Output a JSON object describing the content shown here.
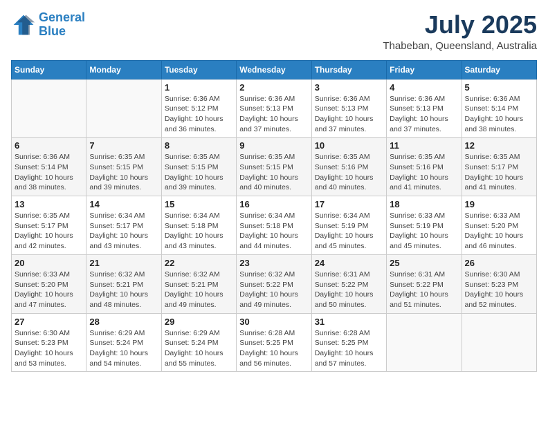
{
  "logo": {
    "line1": "General",
    "line2": "Blue"
  },
  "title": "July 2025",
  "location": "Thabeban, Queensland, Australia",
  "days_of_week": [
    "Sunday",
    "Monday",
    "Tuesday",
    "Wednesday",
    "Thursday",
    "Friday",
    "Saturday"
  ],
  "weeks": [
    [
      {
        "day": "",
        "sunrise": "",
        "sunset": "",
        "daylight": ""
      },
      {
        "day": "",
        "sunrise": "",
        "sunset": "",
        "daylight": ""
      },
      {
        "day": "1",
        "sunrise": "Sunrise: 6:36 AM",
        "sunset": "Sunset: 5:12 PM",
        "daylight": "Daylight: 10 hours and 36 minutes."
      },
      {
        "day": "2",
        "sunrise": "Sunrise: 6:36 AM",
        "sunset": "Sunset: 5:13 PM",
        "daylight": "Daylight: 10 hours and 37 minutes."
      },
      {
        "day": "3",
        "sunrise": "Sunrise: 6:36 AM",
        "sunset": "Sunset: 5:13 PM",
        "daylight": "Daylight: 10 hours and 37 minutes."
      },
      {
        "day": "4",
        "sunrise": "Sunrise: 6:36 AM",
        "sunset": "Sunset: 5:13 PM",
        "daylight": "Daylight: 10 hours and 37 minutes."
      },
      {
        "day": "5",
        "sunrise": "Sunrise: 6:36 AM",
        "sunset": "Sunset: 5:14 PM",
        "daylight": "Daylight: 10 hours and 38 minutes."
      }
    ],
    [
      {
        "day": "6",
        "sunrise": "Sunrise: 6:36 AM",
        "sunset": "Sunset: 5:14 PM",
        "daylight": "Daylight: 10 hours and 38 minutes."
      },
      {
        "day": "7",
        "sunrise": "Sunrise: 6:35 AM",
        "sunset": "Sunset: 5:15 PM",
        "daylight": "Daylight: 10 hours and 39 minutes."
      },
      {
        "day": "8",
        "sunrise": "Sunrise: 6:35 AM",
        "sunset": "Sunset: 5:15 PM",
        "daylight": "Daylight: 10 hours and 39 minutes."
      },
      {
        "day": "9",
        "sunrise": "Sunrise: 6:35 AM",
        "sunset": "Sunset: 5:15 PM",
        "daylight": "Daylight: 10 hours and 40 minutes."
      },
      {
        "day": "10",
        "sunrise": "Sunrise: 6:35 AM",
        "sunset": "Sunset: 5:16 PM",
        "daylight": "Daylight: 10 hours and 40 minutes."
      },
      {
        "day": "11",
        "sunrise": "Sunrise: 6:35 AM",
        "sunset": "Sunset: 5:16 PM",
        "daylight": "Daylight: 10 hours and 41 minutes."
      },
      {
        "day": "12",
        "sunrise": "Sunrise: 6:35 AM",
        "sunset": "Sunset: 5:17 PM",
        "daylight": "Daylight: 10 hours and 41 minutes."
      }
    ],
    [
      {
        "day": "13",
        "sunrise": "Sunrise: 6:35 AM",
        "sunset": "Sunset: 5:17 PM",
        "daylight": "Daylight: 10 hours and 42 minutes."
      },
      {
        "day": "14",
        "sunrise": "Sunrise: 6:34 AM",
        "sunset": "Sunset: 5:17 PM",
        "daylight": "Daylight: 10 hours and 43 minutes."
      },
      {
        "day": "15",
        "sunrise": "Sunrise: 6:34 AM",
        "sunset": "Sunset: 5:18 PM",
        "daylight": "Daylight: 10 hours and 43 minutes."
      },
      {
        "day": "16",
        "sunrise": "Sunrise: 6:34 AM",
        "sunset": "Sunset: 5:18 PM",
        "daylight": "Daylight: 10 hours and 44 minutes."
      },
      {
        "day": "17",
        "sunrise": "Sunrise: 6:34 AM",
        "sunset": "Sunset: 5:19 PM",
        "daylight": "Daylight: 10 hours and 45 minutes."
      },
      {
        "day": "18",
        "sunrise": "Sunrise: 6:33 AM",
        "sunset": "Sunset: 5:19 PM",
        "daylight": "Daylight: 10 hours and 45 minutes."
      },
      {
        "day": "19",
        "sunrise": "Sunrise: 6:33 AM",
        "sunset": "Sunset: 5:20 PM",
        "daylight": "Daylight: 10 hours and 46 minutes."
      }
    ],
    [
      {
        "day": "20",
        "sunrise": "Sunrise: 6:33 AM",
        "sunset": "Sunset: 5:20 PM",
        "daylight": "Daylight: 10 hours and 47 minutes."
      },
      {
        "day": "21",
        "sunrise": "Sunrise: 6:32 AM",
        "sunset": "Sunset: 5:21 PM",
        "daylight": "Daylight: 10 hours and 48 minutes."
      },
      {
        "day": "22",
        "sunrise": "Sunrise: 6:32 AM",
        "sunset": "Sunset: 5:21 PM",
        "daylight": "Daylight: 10 hours and 49 minutes."
      },
      {
        "day": "23",
        "sunrise": "Sunrise: 6:32 AM",
        "sunset": "Sunset: 5:22 PM",
        "daylight": "Daylight: 10 hours and 49 minutes."
      },
      {
        "day": "24",
        "sunrise": "Sunrise: 6:31 AM",
        "sunset": "Sunset: 5:22 PM",
        "daylight": "Daylight: 10 hours and 50 minutes."
      },
      {
        "day": "25",
        "sunrise": "Sunrise: 6:31 AM",
        "sunset": "Sunset: 5:22 PM",
        "daylight": "Daylight: 10 hours and 51 minutes."
      },
      {
        "day": "26",
        "sunrise": "Sunrise: 6:30 AM",
        "sunset": "Sunset: 5:23 PM",
        "daylight": "Daylight: 10 hours and 52 minutes."
      }
    ],
    [
      {
        "day": "27",
        "sunrise": "Sunrise: 6:30 AM",
        "sunset": "Sunset: 5:23 PM",
        "daylight": "Daylight: 10 hours and 53 minutes."
      },
      {
        "day": "28",
        "sunrise": "Sunrise: 6:29 AM",
        "sunset": "Sunset: 5:24 PM",
        "daylight": "Daylight: 10 hours and 54 minutes."
      },
      {
        "day": "29",
        "sunrise": "Sunrise: 6:29 AM",
        "sunset": "Sunset: 5:24 PM",
        "daylight": "Daylight: 10 hours and 55 minutes."
      },
      {
        "day": "30",
        "sunrise": "Sunrise: 6:28 AM",
        "sunset": "Sunset: 5:25 PM",
        "daylight": "Daylight: 10 hours and 56 minutes."
      },
      {
        "day": "31",
        "sunrise": "Sunrise: 6:28 AM",
        "sunset": "Sunset: 5:25 PM",
        "daylight": "Daylight: 10 hours and 57 minutes."
      },
      {
        "day": "",
        "sunrise": "",
        "sunset": "",
        "daylight": ""
      },
      {
        "day": "",
        "sunrise": "",
        "sunset": "",
        "daylight": ""
      }
    ]
  ]
}
